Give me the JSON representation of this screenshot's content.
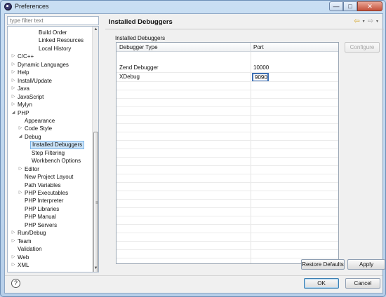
{
  "window": {
    "title": "Preferences",
    "close_label": "✕",
    "min_label": "—",
    "max_label": "□"
  },
  "filter": {
    "placeholder": "type filter text"
  },
  "tree": [
    {
      "label": "Build Order",
      "level": 3,
      "toggle": ""
    },
    {
      "label": "Linked Resources",
      "level": 3,
      "toggle": ""
    },
    {
      "label": "Local History",
      "level": 3,
      "toggle": ""
    },
    {
      "label": "C/C++",
      "level": 0,
      "toggle": "▷"
    },
    {
      "label": "Dynamic Languages",
      "level": 0,
      "toggle": "▷"
    },
    {
      "label": "Help",
      "level": 0,
      "toggle": "▷"
    },
    {
      "label": "Install/Update",
      "level": 0,
      "toggle": "▷"
    },
    {
      "label": "Java",
      "level": 0,
      "toggle": "▷"
    },
    {
      "label": "JavaScript",
      "level": 0,
      "toggle": "▷"
    },
    {
      "label": "Mylyn",
      "level": 0,
      "toggle": "▷"
    },
    {
      "label": "PHP",
      "level": 0,
      "toggle": "◢"
    },
    {
      "label": "Appearance",
      "level": 1,
      "toggle": ""
    },
    {
      "label": "Code Style",
      "level": 1,
      "toggle": "▷"
    },
    {
      "label": "Debug",
      "level": 1,
      "toggle": "◢"
    },
    {
      "label": "Installed Debuggers",
      "level": 2,
      "toggle": "",
      "selected": true
    },
    {
      "label": "Step Filtering",
      "level": 2,
      "toggle": ""
    },
    {
      "label": "Workbench Options",
      "level": 2,
      "toggle": ""
    },
    {
      "label": "Editor",
      "level": 1,
      "toggle": "▷"
    },
    {
      "label": "New Project Layout",
      "level": 1,
      "toggle": ""
    },
    {
      "label": "Path Variables",
      "level": 1,
      "toggle": ""
    },
    {
      "label": "PHP Executables",
      "level": 1,
      "toggle": "▷"
    },
    {
      "label": "PHP Interpreter",
      "level": 1,
      "toggle": ""
    },
    {
      "label": "PHP Libraries",
      "level": 1,
      "toggle": ""
    },
    {
      "label": "PHP Manual",
      "level": 1,
      "toggle": ""
    },
    {
      "label": "PHP Servers",
      "level": 1,
      "toggle": ""
    },
    {
      "label": "Run/Debug",
      "level": 0,
      "toggle": "▷"
    },
    {
      "label": "Team",
      "level": 0,
      "toggle": "▷"
    },
    {
      "label": "Validation",
      "level": 0,
      "toggle": ""
    },
    {
      "label": "Web",
      "level": 0,
      "toggle": "▷"
    },
    {
      "label": "XML",
      "level": 0,
      "toggle": "▷"
    }
  ],
  "page": {
    "title": "Installed Debuggers",
    "section_label": "Installed Debuggers",
    "back_icon": "⇦",
    "forward_icon": "⇨",
    "dropdown_icon": "▾"
  },
  "table": {
    "headers": [
      "Debugger Type",
      "Port"
    ],
    "rows": [
      {
        "type": "Zend Debugger",
        "port": "10000"
      },
      {
        "type": "XDebug",
        "port": ""
      }
    ],
    "editing_value": "9090"
  },
  "buttons": {
    "configure": "Configure",
    "restore_defaults": "Restore Defaults",
    "apply": "Apply",
    "ok": "OK",
    "cancel": "Cancel",
    "help": "?"
  },
  "colors": {
    "selection_bg": "#cde6fb",
    "editor_border": "#3c6fb4"
  }
}
